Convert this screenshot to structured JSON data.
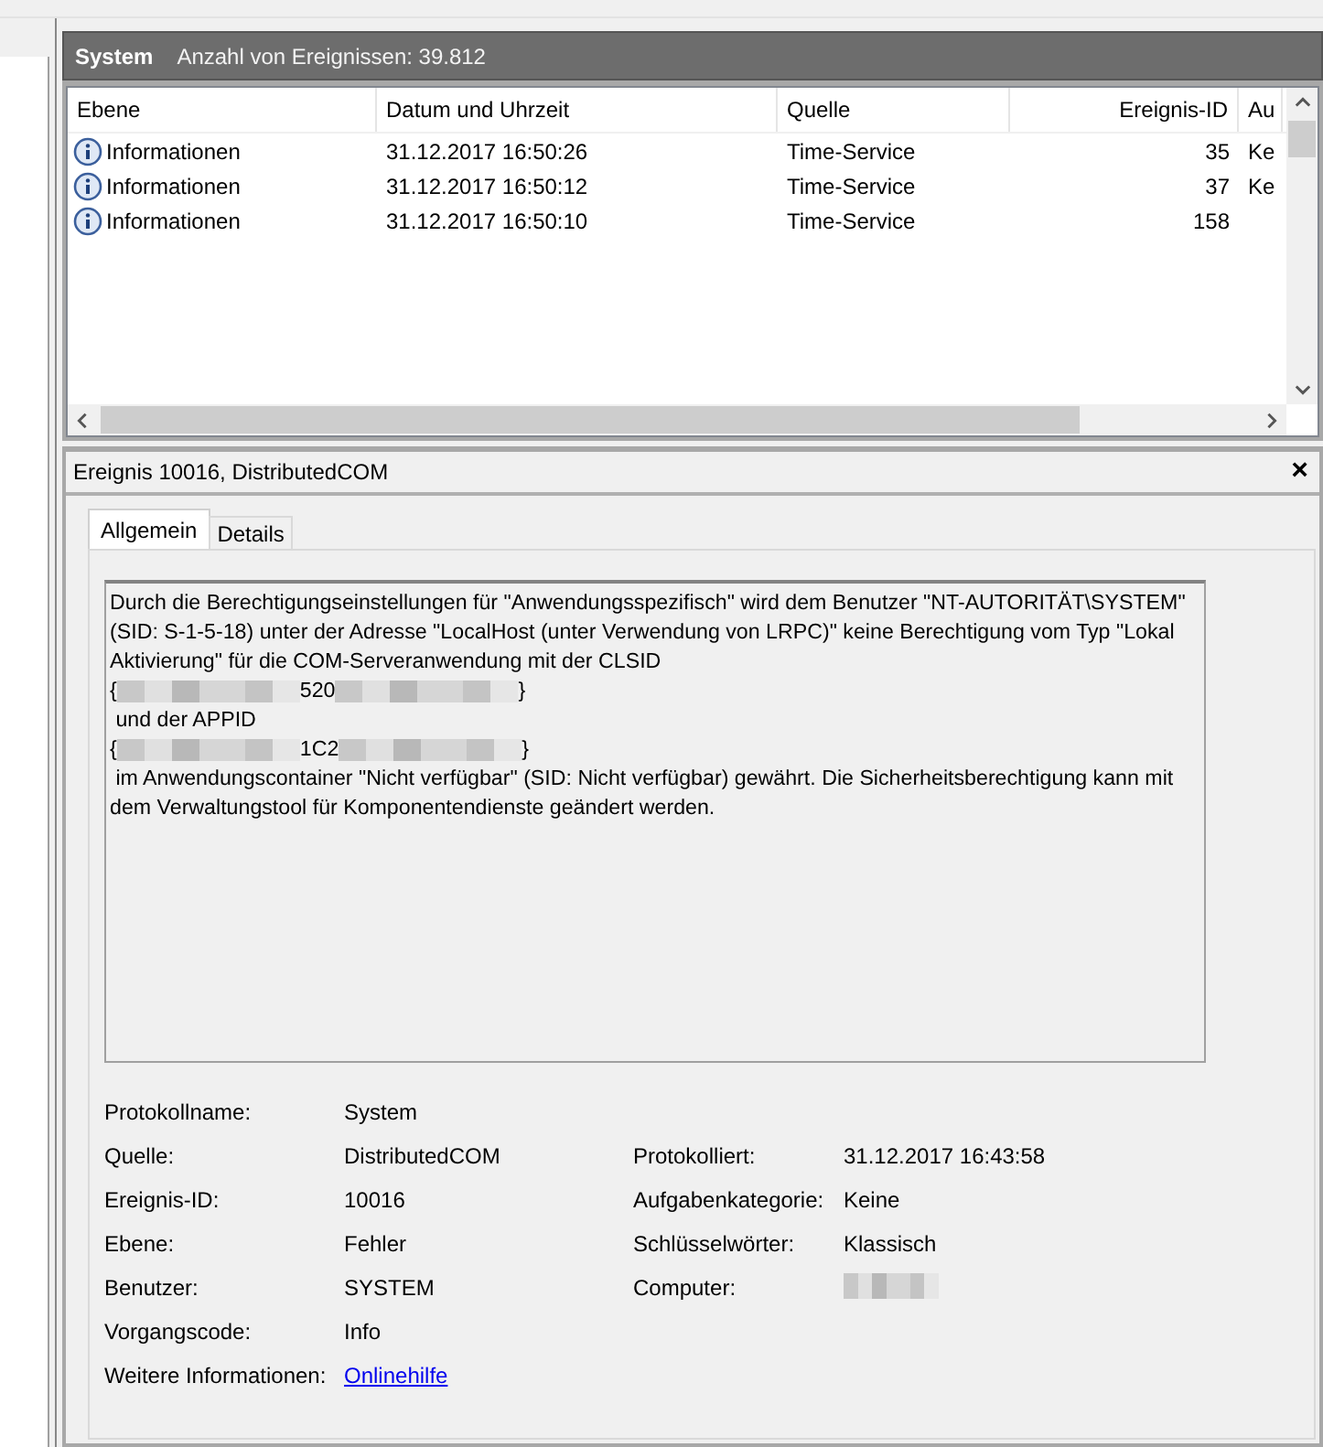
{
  "header": {
    "title": "System",
    "count": "Anzahl von Ereignissen: 39.812"
  },
  "table": {
    "columns": [
      "Ebene",
      "Datum und Uhrzeit",
      "Quelle",
      "Ereignis-ID",
      "Au"
    ],
    "rows": [
      {
        "level": "Informationen",
        "date": "31.12.2017 16:50:26",
        "source": "Time-Service",
        "id": "35",
        "column_5": "Ke"
      },
      {
        "level": "Informationen",
        "date": "31.12.2017 16:50:12",
        "source": "Time-Service",
        "id": "37",
        "column_5": "Ke"
      },
      {
        "level": "Informationen",
        "date": "31.12.2017 16:50:10",
        "source": "Time-Service",
        "id": "158",
        "column_5": ""
      }
    ]
  },
  "detail": {
    "title": "Ereignis 10016, DistributedCOM",
    "close": "×",
    "tabs": [
      {
        "label": "Allgemein",
        "selected": true
      },
      {
        "label": "Details",
        "selected": false
      }
    ],
    "message": [
      [
        {
          "kind": "text",
          "text": "Durch die Berechtigungseinstellungen für \"Anwendungsspezifisch\" wird dem Benutzer \"NT-AUTORITÄT\\SYSTEM\" (SID: S-1-5-18) unter der Adresse \"LocalHost (unter Verwendung von LRPC)\" keine Berechtigung vom Typ \"Lokal Aktivierung\" für die COM-Serveranwendung mit der CLSID"
        }
      ],
      [
        {
          "kind": "text",
          "text": "{"
        },
        {
          "kind": "redacted"
        },
        {
          "kind": "text",
          "text": "520"
        },
        {
          "kind": "redacted"
        },
        {
          "kind": "text",
          "text": "}"
        }
      ],
      [
        {
          "kind": "text",
          "text": " und der APPID"
        }
      ],
      [
        {
          "kind": "text",
          "text": "{"
        },
        {
          "kind": "redacted"
        },
        {
          "kind": "text",
          "text": "1C2"
        },
        {
          "kind": "redacted"
        },
        {
          "kind": "text",
          "text": "}"
        }
      ],
      [
        {
          "kind": "text",
          "text": " im Anwendungscontainer \"Nicht verfügbar\" (SID: Nicht verfügbar) gewährt. Die Sicherheitsberechtigung kann mit dem Verwaltungstool für Komponentendienste geändert werden."
        }
      ]
    ],
    "fields": [
      [
        {
          "label": "Protokollname:",
          "value": "System"
        }
      ],
      [
        {
          "label": "Quelle:",
          "value": "DistributedCOM"
        },
        {
          "label": "Protokolliert:",
          "value": "31.12.2017 16:43:58"
        }
      ],
      [
        {
          "label": "Ereignis-ID:",
          "value": "10016"
        },
        {
          "label": "Aufgabenkategorie:",
          "value": "Keine"
        }
      ],
      [
        {
          "label": "Ebene:",
          "value": "Fehler"
        },
        {
          "label": "Schlüsselwörter:",
          "value": "Klassisch"
        }
      ],
      [
        {
          "label": "Benutzer:",
          "value": "SYSTEM"
        },
        {
          "label": "Computer:",
          "kind": "redacted"
        }
      ],
      [
        {
          "label": "Vorgangscode:",
          "value": "Info"
        }
      ],
      [
        {
          "label": "Weitere Informationen:",
          "link": "Onlinehilfe"
        }
      ]
    ]
  }
}
